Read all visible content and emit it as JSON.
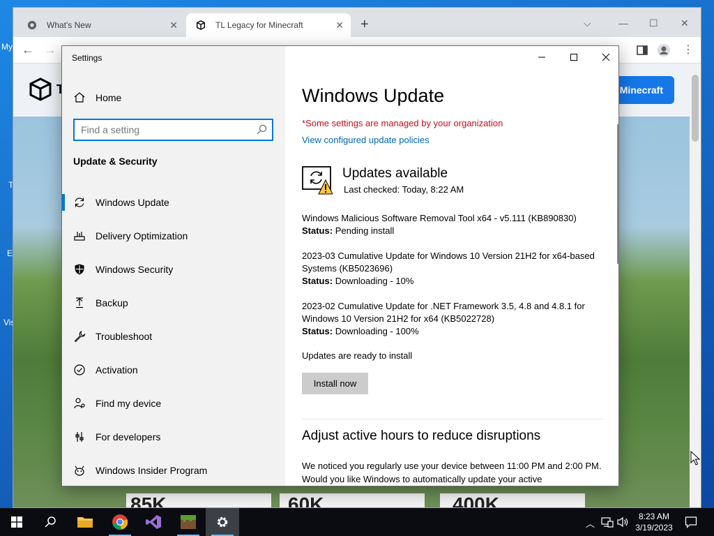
{
  "desktop": {
    "icon_labels": [
      "My",
      "T",
      "E",
      "Vis"
    ]
  },
  "browser": {
    "tabs": [
      {
        "label": "What's New"
      },
      {
        "label": "TL Legacy for Minecraft"
      }
    ],
    "site": {
      "header_initial": "T",
      "button_label": "Minecraft",
      "stats": [
        "85K",
        "60K",
        "400K"
      ]
    }
  },
  "settings": {
    "window_title": "Settings",
    "home_label": "Home",
    "search_placeholder": "Find a setting",
    "section_title": "Update & Security",
    "nav_items": [
      {
        "label": "Windows Update",
        "icon": "refresh-icon"
      },
      {
        "label": "Delivery Optimization",
        "icon": "delivery-icon"
      },
      {
        "label": "Windows Security",
        "icon": "shield-icon"
      },
      {
        "label": "Backup",
        "icon": "backup-icon"
      },
      {
        "label": "Troubleshoot",
        "icon": "wrench-icon"
      },
      {
        "label": "Activation",
        "icon": "check-circle-icon"
      },
      {
        "label": "Find my device",
        "icon": "person-pin-icon"
      },
      {
        "label": "For developers",
        "icon": "developer-icon"
      },
      {
        "label": "Windows Insider Program",
        "icon": "insider-icon"
      }
    ],
    "main": {
      "title": "Windows Update",
      "org_notice": "*Some settings are managed by your organization",
      "policies_link": "View configured update policies",
      "status_title": "Updates available",
      "last_checked": "Last checked: Today, 8:22 AM",
      "status_label": "Status:",
      "updates": [
        {
          "name": "Windows Malicious Software Removal Tool x64 - v5.111 (KB890830)",
          "status": "Pending install"
        },
        {
          "name": "2023-03 Cumulative Update for Windows 10 Version 21H2 for x64-based Systems (KB5023696)",
          "status": "Downloading - 10%"
        },
        {
          "name": "2023-02 Cumulative Update for .NET Framework 3.5, 4.8 and 4.8.1 for Windows 10 Version 21H2 for x64 (KB5022728)",
          "status": "Downloading - 100%"
        }
      ],
      "ready_text": "Updates are ready to install",
      "install_button": "Install now",
      "active_hours_title": "Adjust active hours to reduce disruptions",
      "active_hours_text": "We noticed you regularly use your device between 11:00 PM and 2:00 PM. Would you like Windows to automatically update your active"
    }
  },
  "taskbar": {
    "time": "8:23 AM",
    "date": "3/19/2023"
  },
  "colors": {
    "accent": "#0078d7",
    "org_notice": "#c50f1f",
    "link": "#0067b8",
    "taskbar": "#0a0c12"
  }
}
